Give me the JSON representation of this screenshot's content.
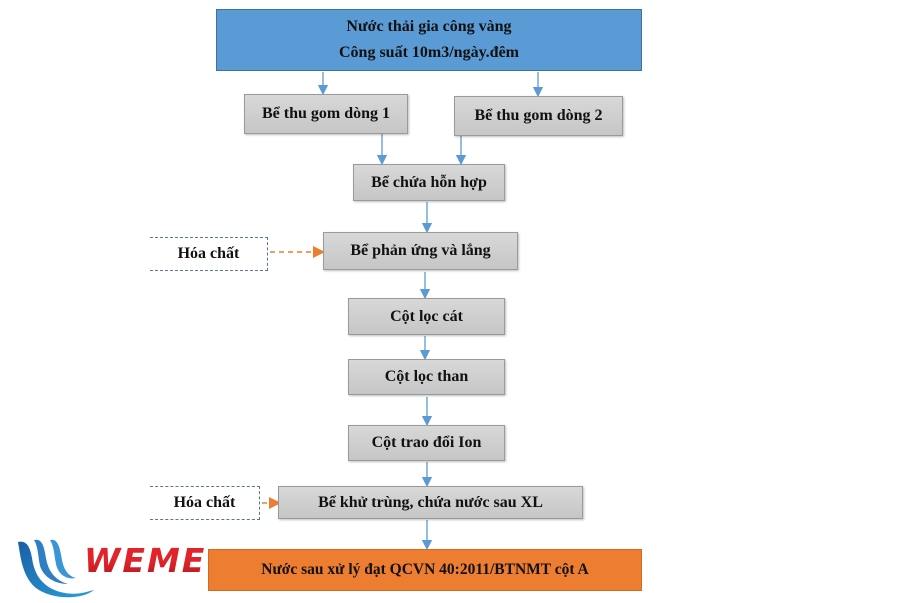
{
  "diagram": {
    "source": {
      "line1": "Nước thải gia công vàng",
      "line2": "Công suất 10m3/ngày.đêm"
    },
    "steps": {
      "collect1": "Bể thu gom dòng 1",
      "collect2": "Bể thu gom dòng 2",
      "mixing": "Bể chứa hỗn hợp",
      "reaction": "Bể phản ứng và lắng",
      "sand_filter": "Cột lọc cát",
      "carbon_filter": "Cột lọc than",
      "ion_exchange": "Cột trao đổi Ion",
      "disinfection": "Bể khử trùng, chứa nước sau XL"
    },
    "chemicals": {
      "chem1": "Hóa chất",
      "chem2": "Hóa chất"
    },
    "output": "Nước sau xử lý đạt QCVN 40:2011/BTNMT cột A",
    "colors": {
      "source_fill": "#5b9bd5",
      "step_fill": "#d0d0d0",
      "output_fill": "#ed7d31",
      "flow_arrow": "#5b9bd5",
      "chemical_arrow": "#ed7d31",
      "chemical_border": "#5a73a8"
    }
  },
  "logo": {
    "text": "WEME"
  }
}
